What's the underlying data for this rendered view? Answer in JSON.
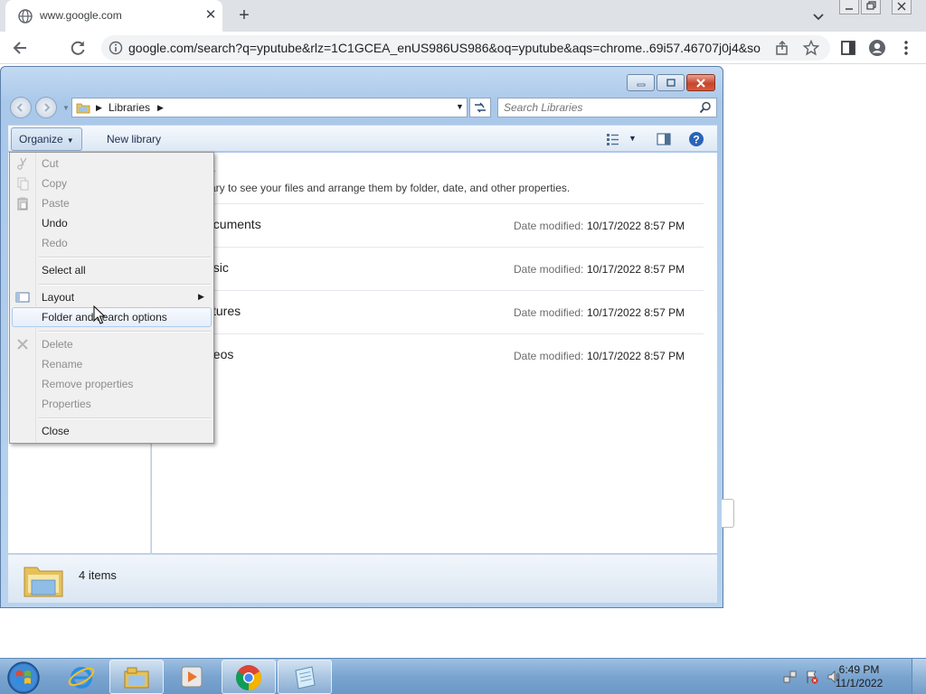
{
  "browser": {
    "tab_title": "www.google.com",
    "url": "google.com/search?q=yputube&rlz=1C1GCEA_enUS986US986&oq=yputube&aqs=chrome..69i57.46707j0j4&so..."
  },
  "explorer": {
    "breadcrumb": [
      "Libraries"
    ],
    "search_placeholder": "Search Libraries",
    "toolbar": {
      "organize_label": "Organize",
      "new_library_label": "New library"
    },
    "heading": "es",
    "description": "rary to see your files and arrange them by folder, date, and other properties.",
    "libraries": [
      {
        "name": "ocuments",
        "modified_label": "Date modified:",
        "modified": "10/17/2022 8:57 PM"
      },
      {
        "name": "usic",
        "modified_label": "Date modified:",
        "modified": "10/17/2022 8:57 PM"
      },
      {
        "name": "ctures",
        "modified_label": "Date modified:",
        "modified": "10/17/2022 8:57 PM"
      },
      {
        "name": "deos",
        "modified_label": "Date modified:",
        "modified": "10/17/2022 8:57 PM"
      }
    ],
    "status": {
      "count": "4 items"
    }
  },
  "organize_menu": {
    "items": [
      {
        "label": "Cut",
        "disabled": true,
        "icon": "scissors-icon"
      },
      {
        "label": "Copy",
        "disabled": true,
        "icon": "copy-icon"
      },
      {
        "label": "Paste",
        "disabled": true,
        "icon": "paste-icon"
      },
      {
        "label": "Undo",
        "disabled": false
      },
      {
        "label": "Redo",
        "disabled": true
      },
      {
        "label": "Select all",
        "disabled": false
      },
      {
        "label": "Layout",
        "disabled": false,
        "icon": "layout-icon",
        "submenu": true
      },
      {
        "label": "Folder and search options",
        "disabled": false,
        "hover": true
      },
      {
        "label": "Delete",
        "disabled": true,
        "icon": "delete-icon"
      },
      {
        "label": "Rename",
        "disabled": true
      },
      {
        "label": "Remove properties",
        "disabled": true
      },
      {
        "label": "Properties",
        "disabled": true
      },
      {
        "label": "Close",
        "disabled": false
      }
    ]
  },
  "taskbar": {
    "apps": [
      "internet-explorer-icon",
      "windows-explorer-icon",
      "media-player-icon",
      "chrome-icon",
      "notepad-icon"
    ],
    "clock": {
      "time": "6:49 PM",
      "date": "11/1/2022"
    }
  },
  "colors": {
    "library_heading": "#1e6a39",
    "menu_hover": "#aecbef",
    "taskbar": "#7aa4cf"
  }
}
